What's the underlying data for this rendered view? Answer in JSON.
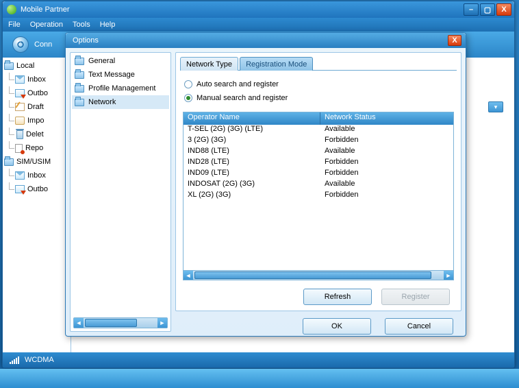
{
  "window": {
    "title": "Mobile Partner",
    "menus": [
      "File",
      "Operation",
      "Tools",
      "Help"
    ],
    "toolbar_btn": "Conn"
  },
  "tree": {
    "local": "Local",
    "local_items": [
      {
        "icon": "inbox",
        "label": "Inbox"
      },
      {
        "icon": "outbox",
        "label": "Outbo"
      },
      {
        "icon": "draft",
        "label": "Draft"
      },
      {
        "icon": "import",
        "label": "Impo"
      },
      {
        "icon": "delete",
        "label": "Delet"
      },
      {
        "icon": "report",
        "label": "Repo"
      }
    ],
    "sim": "SIM/USIM",
    "sim_items": [
      {
        "icon": "inbox",
        "label": "Inbox"
      },
      {
        "icon": "outbox",
        "label": "Outbo"
      }
    ]
  },
  "status": {
    "net": "WCDMA"
  },
  "dialog": {
    "title": "Options",
    "categories": [
      "General",
      "Text Message",
      "Profile Management",
      "Network"
    ],
    "selected_cat": 3,
    "tabs": [
      "Network Type",
      "Registration Mode"
    ],
    "active_tab": 1,
    "radios": {
      "auto": "Auto search and register",
      "manual": "Manual search and register",
      "selected": "manual"
    },
    "grid": {
      "headers": [
        "Operator Name",
        "Network Status"
      ],
      "rows": [
        {
          "op": "T-SEL (2G) (3G) (LTE)",
          "st": "Available"
        },
        {
          "op": "3 (2G) (3G)",
          "st": "Forbidden"
        },
        {
          "op": "IND88 (LTE)",
          "st": "Available"
        },
        {
          "op": "IND28 (LTE)",
          "st": "Forbidden"
        },
        {
          "op": "IND09 (LTE)",
          "st": "Forbidden"
        },
        {
          "op": "INDOSAT (2G) (3G)",
          "st": "Available"
        },
        {
          "op": "XL (2G) (3G)",
          "st": "Forbidden"
        }
      ]
    },
    "buttons": {
      "refresh": "Refresh",
      "register": "Register",
      "ok": "OK",
      "cancel": "Cancel"
    }
  }
}
